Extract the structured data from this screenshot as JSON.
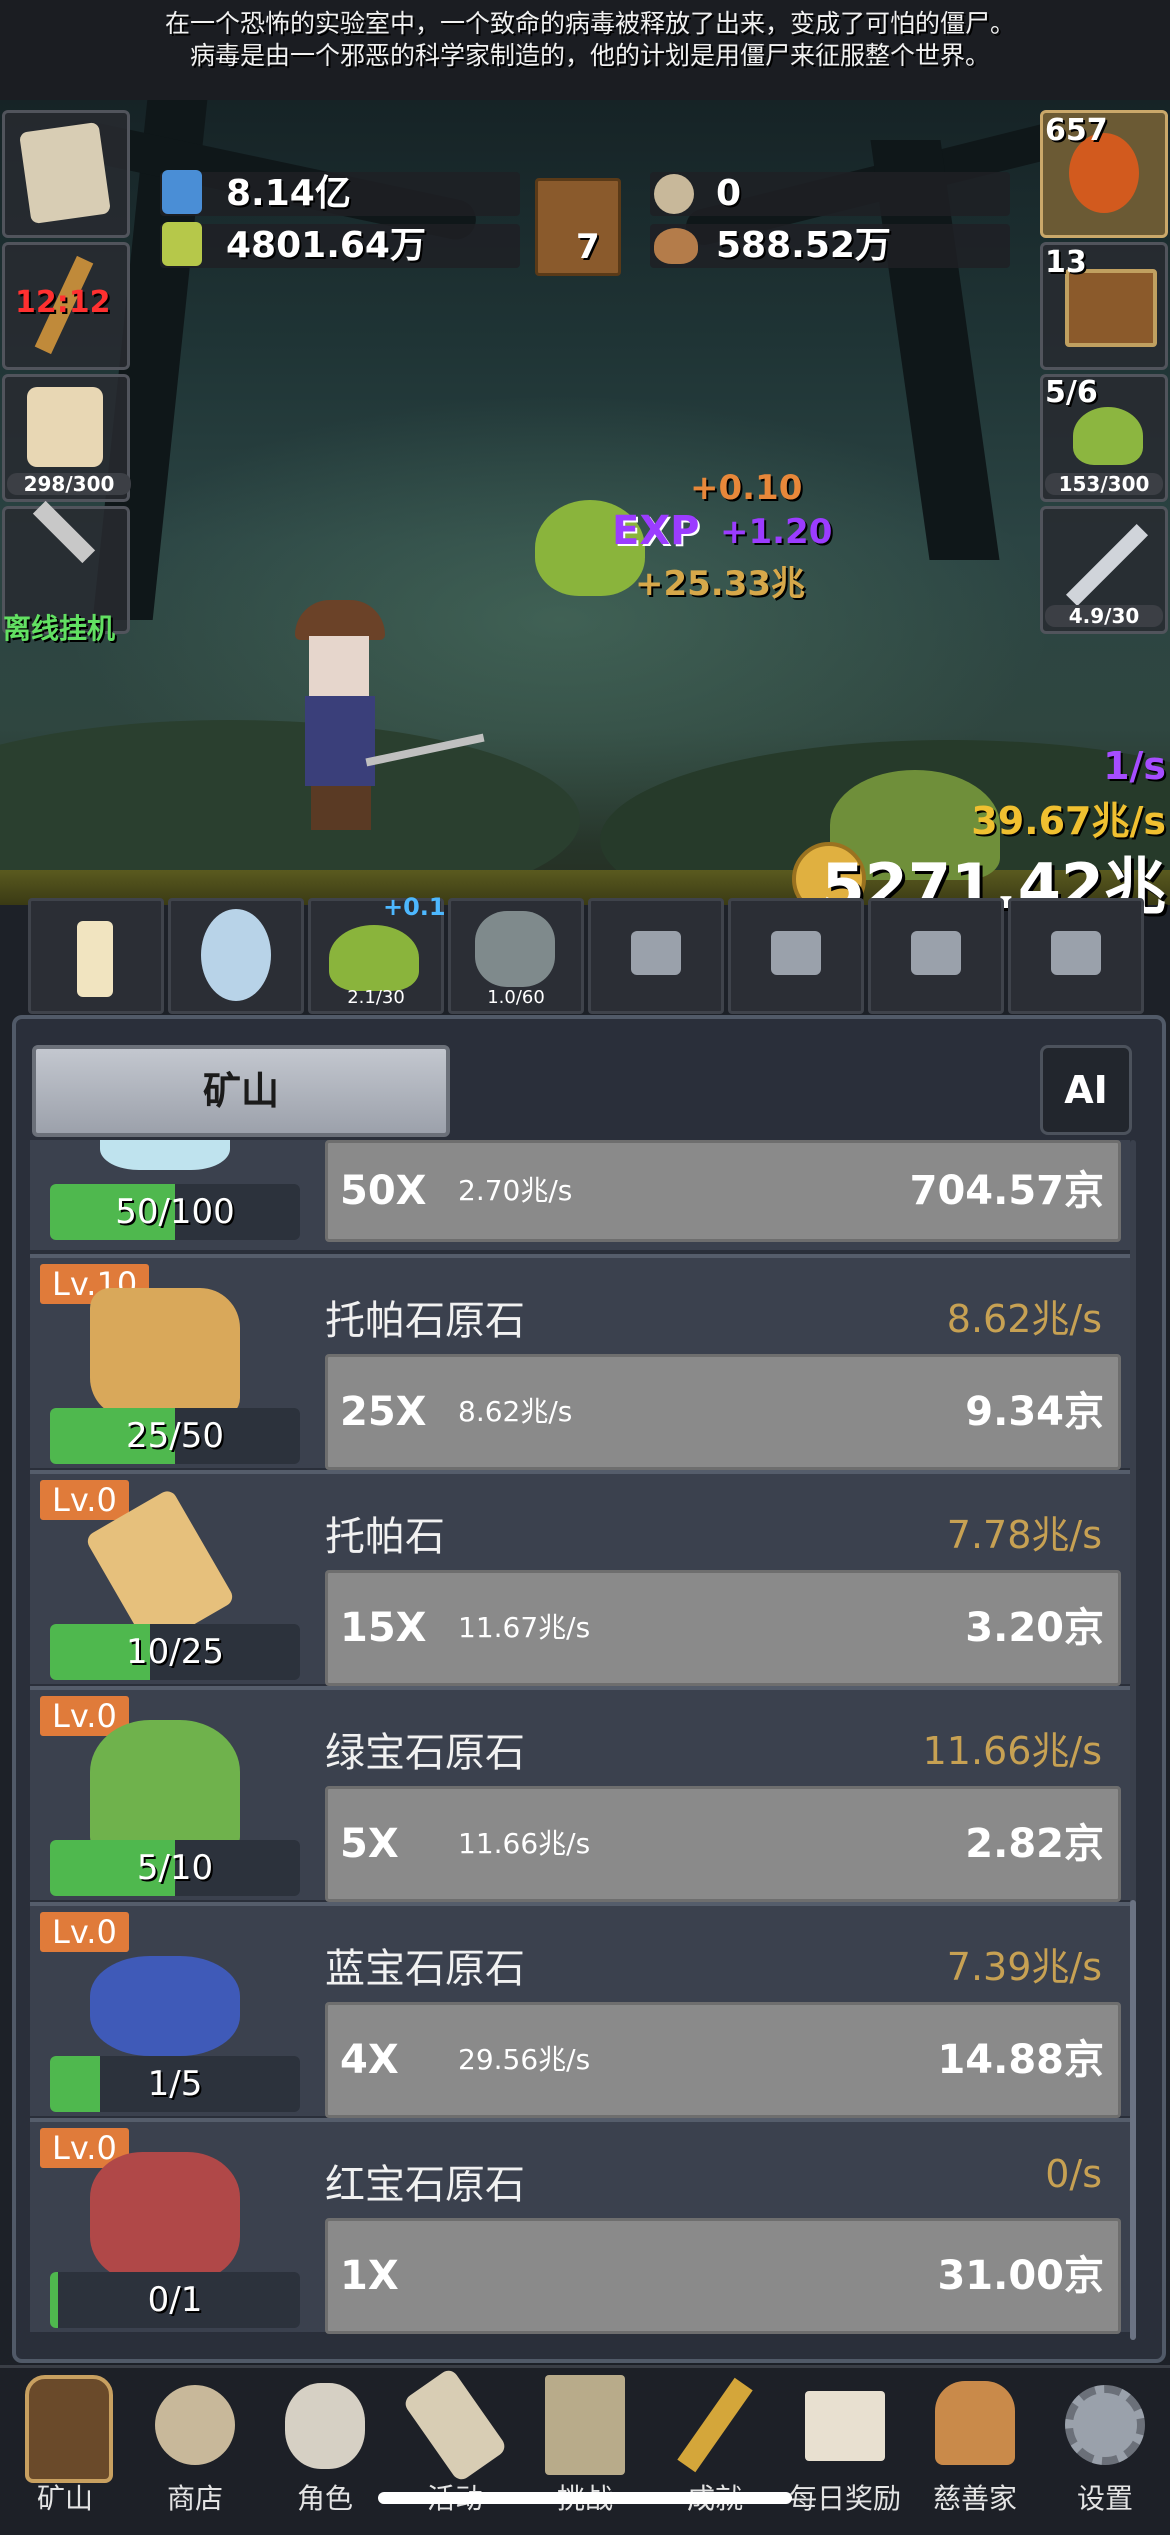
{
  "story": {
    "line1": "在一个恐怖的实验室中，一个致命的病毒被释放了出来，变成了可怕的僵尸。",
    "line2": "病毒是由一个邪恶的科学家制造的，他的计划是用僵尸来征服整个世界。"
  },
  "resources": {
    "blue_potion": "8.14亿",
    "green_potion": "4801.64万",
    "book_count": "7",
    "shell": "0",
    "meat": "588.52万"
  },
  "left_slots": {
    "torch_time": "12:12",
    "food_bar": "298/300",
    "offline_label": "离线挂机"
  },
  "right_slots": {
    "potion_count": "657",
    "chest_count": "13",
    "slime_wave": "5/6",
    "slime_bar": "153/300",
    "sword_bar": "4.9/30"
  },
  "battle": {
    "gain_gold": "+0.10",
    "gain_exp": "+1.20",
    "gain_money": "+25.33兆",
    "exp_label": "EXP",
    "rate_small": "1/s",
    "rate_money": "39.67兆/s",
    "total_money": "5271.42兆"
  },
  "pets": [
    {
      "name": "candle",
      "label": ""
    },
    {
      "name": "egg",
      "label": ""
    },
    {
      "name": "slime",
      "label": "2.1/30",
      "bonus": "+0.1"
    },
    {
      "name": "zombie",
      "label": "1.0/60"
    },
    {
      "name": "locked-1",
      "label": ""
    },
    {
      "name": "locked-2",
      "label": ""
    },
    {
      "name": "locked-3",
      "label": ""
    },
    {
      "name": "locked-4",
      "label": ""
    }
  ],
  "panel": {
    "tab_label": "矿山",
    "ai_label": "AI"
  },
  "rows": [
    {
      "level": "",
      "name": "",
      "rate": "",
      "progress": "50/100",
      "fill": 0.5,
      "mult": "50X",
      "buy_rate": "2.70兆/s",
      "cost": "704.57京",
      "gem_color": "#bfe3ee"
    },
    {
      "level": "Lv.10",
      "name": "托帕石原石",
      "rate": "8.62兆/s",
      "progress": "25/50",
      "fill": 0.5,
      "mult": "25X",
      "buy_rate": "8.62兆/s",
      "cost": "9.34京",
      "gem_color": "#d9a85a"
    },
    {
      "level": "Lv.0",
      "name": "托帕石",
      "rate": "7.78兆/s",
      "progress": "10/25",
      "fill": 0.4,
      "mult": "15X",
      "buy_rate": "11.67兆/s",
      "cost": "3.20京",
      "gem_color": "#e6c07c"
    },
    {
      "level": "Lv.0",
      "name": "绿宝石原石",
      "rate": "11.66兆/s",
      "progress": "5/10",
      "fill": 0.5,
      "mult": "5X",
      "buy_rate": "11.66兆/s",
      "cost": "2.82京",
      "gem_color": "#6fb24c"
    },
    {
      "level": "Lv.0",
      "name": "蓝宝石原石",
      "rate": "7.39兆/s",
      "progress": "1/5",
      "fill": 0.2,
      "mult": "4X",
      "buy_rate": "29.56兆/s",
      "cost": "14.88京",
      "gem_color": "#3f5ab8"
    },
    {
      "level": "Lv.0",
      "name": "红宝石原石",
      "rate": "0/s",
      "progress": "0/1",
      "fill": 0.0,
      "mult": "1X",
      "buy_rate": "",
      "cost": "31.00京",
      "gem_color": "#b04848"
    }
  ],
  "nav": [
    {
      "label": "矿山",
      "icon": "lantern-icon"
    },
    {
      "label": "商店",
      "icon": "shell-icon"
    },
    {
      "label": "角色",
      "icon": "skull-icon"
    },
    {
      "label": "活动",
      "icon": "scroll-icon"
    },
    {
      "label": "挑战",
      "icon": "map-icon"
    },
    {
      "label": "成就",
      "icon": "key-icon"
    },
    {
      "label": "每日奖励",
      "icon": "letter-icon"
    },
    {
      "label": "慈善家",
      "icon": "bread-icon"
    },
    {
      "label": "设置",
      "icon": "gear-icon"
    }
  ],
  "colors": {
    "accent_orange": "#e07b3a",
    "progress_green": "#4fb84e",
    "rate_gold": "#c7a153",
    "exp_purple": "#9b3cff"
  }
}
